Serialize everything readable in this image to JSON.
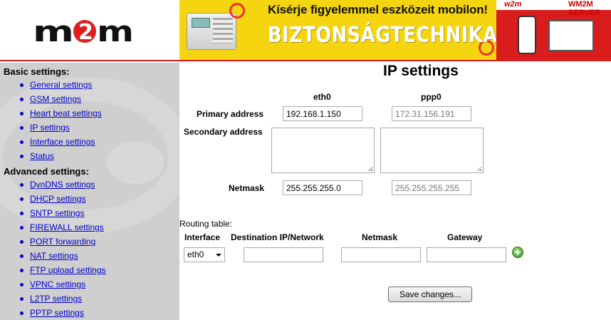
{
  "header": {
    "logo_text": "m2m",
    "banner_tagline": "Kísérje figyelemmel eszközeit mobilon!",
    "banner_title": "BIZTONSÁGTECHNIKA",
    "banner_wm_logo": "w2m",
    "banner_server": "WM2M SERVER"
  },
  "sidebar": {
    "basic_title": "Basic settings:",
    "basic_items": [
      "General settings",
      "GSM settings",
      "Heart beat settings",
      "IP settings",
      "Interface settings",
      "Status"
    ],
    "advanced_title": "Advanced settings:",
    "advanced_items": [
      "DynDNS settings",
      "DHCP settings",
      "SNTP settings",
      "FIREWALL settings",
      "PORT forwarding",
      "NAT settings",
      "FTP upload settings",
      "VPNC settings",
      "L2TP settings",
      "PPTP settings"
    ]
  },
  "main": {
    "title": "IP settings",
    "col_eth0": "eth0",
    "col_ppp0": "ppp0",
    "primary_label": "Primary address",
    "primary_eth0": "192.168.1.150",
    "primary_ppp0": "172.31.156.191",
    "secondary_label": "Secondary address",
    "netmask_label": "Netmask",
    "netmask_eth0": "255.255.255.0",
    "netmask_ppp0": "255.255.255.255",
    "routing_title": "Routing table:",
    "routing_headers": {
      "interface": "Interface",
      "destination": "Destination IP/Network",
      "netmask": "Netmask",
      "gateway": "Gateway"
    },
    "routing_interface_value": "eth0",
    "save_label": "Save changes..."
  },
  "colors": {
    "accent_red": "#d42020",
    "banner_yellow": "#f4d510",
    "sidebar_gray": "#cfcfcf",
    "link_blue": "#0000cc"
  }
}
